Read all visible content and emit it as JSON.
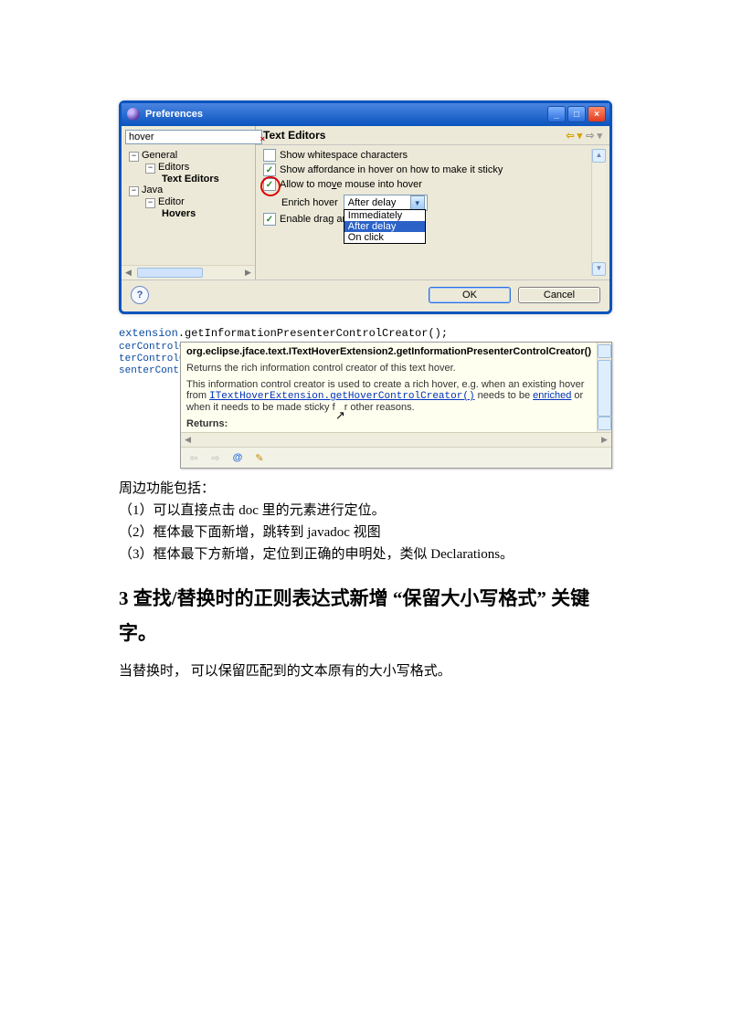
{
  "dialog": {
    "title": "Preferences",
    "filter_value": "hover",
    "tree": {
      "general": "General",
      "editors": "Editors",
      "text_editors": "Text Editors",
      "java": "Java",
      "editor": "Editor",
      "hovers": "Hovers"
    },
    "right_header": "Text Editors",
    "options": {
      "show_whitespace": "Show whitespace characters",
      "show_affordance": "Show affordance in hover on how to make it sticky",
      "allow_mouse_pre": "Allow to mo",
      "allow_mouse_u": "v",
      "allow_mouse_post": "e mouse into hover",
      "enrich_hover": "Enrich hover",
      "enable_drag": "Enable drag and drop"
    },
    "dropdown": {
      "selected": "After delay",
      "items": [
        "Immediately",
        "After delay",
        "On click"
      ]
    },
    "footer": {
      "help": "?",
      "ok": "OK",
      "cancel": "Cancel"
    }
  },
  "code": {
    "receiver": "extension",
    "call": ".getInformationPresenterControlCreator();",
    "left_frag1": "cerControlC",
    "left_frag2": "terControlC",
    "left_frag3": "senterContr"
  },
  "javadoc": {
    "qname": "org.eclipse.jface.text.ITextHoverExtension2.getInformationPresenterControlCreator()",
    "p1": "Returns the rich information control creator of this text hover.",
    "p2a": "This information control creator is used to create a rich hover, e.g. when an existing hover from ",
    "link1": "ITextHoverExtension.getHoverControlCreator()",
    "p2b": " needs to be ",
    "link2": "enriched",
    "p2c": " or when it needs to be made sticky f",
    "p2d": "r other reasons.",
    "returns": "Returns:",
    "toolbar_at": "@"
  },
  "prose": {
    "intro": "周边功能包括：",
    "li1": "（1）可以直接点击 doc 里的元素进行定位。",
    "li2": "（2）框体最下面新增，跳转到 javadoc 视图",
    "li3": "（3）框体最下方新增，定位到正确的申明处，类似 Declarations。",
    "h3": "3  查找/替换时的正则表达式新增 “保留大小写格式” 关键字。",
    "p_after": "当替换时，  可以保留匹配到的文本原有的大小写格式。"
  }
}
